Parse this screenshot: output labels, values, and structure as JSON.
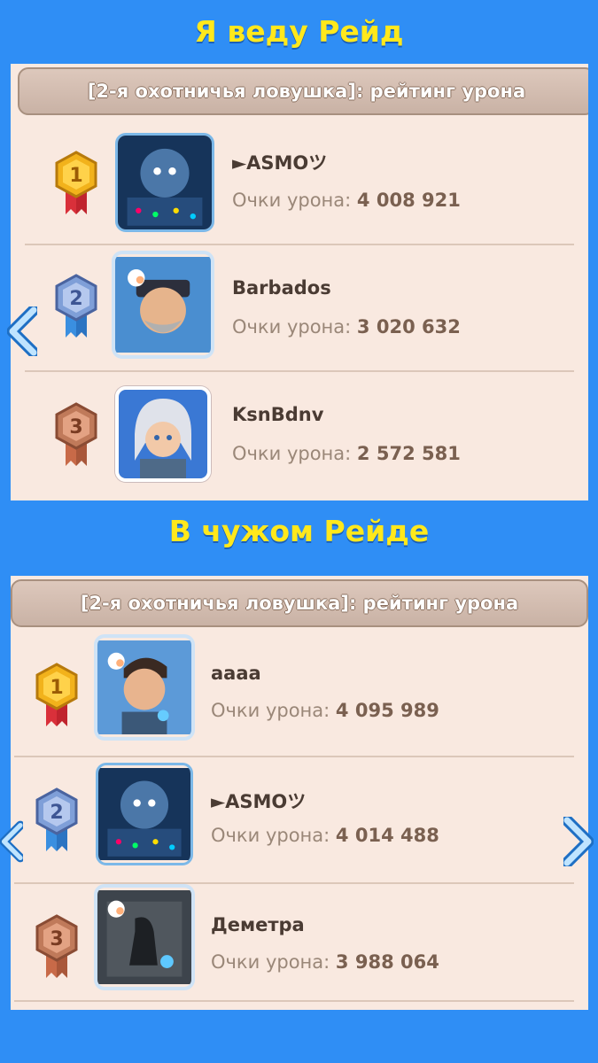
{
  "captions": {
    "top": "Я веду Рейд",
    "bottom": "В чужом Рейде"
  },
  "panels": [
    {
      "header": "[2-я охотничья ловушка]: рейтинг урона",
      "rows": [
        {
          "rank": "1",
          "name": "►ASMOツ",
          "score_label": "Очки урона:",
          "score": "4 008 921",
          "avatar": "yeti-avatar-icon"
        },
        {
          "rank": "2",
          "name": "Barbados",
          "score_label": "Очки урона:",
          "score": "3 020 632",
          "avatar": "captain-avatar-icon"
        },
        {
          "rank": "3",
          "name": "KsnBdnv",
          "score_label": "Очки урона:",
          "score": "2 572 581",
          "avatar": "white-haired-avatar-icon"
        }
      ]
    },
    {
      "header": "[2-я охотничья ловушка]: рейтинг урона",
      "rows": [
        {
          "rank": "1",
          "name": "aaaa",
          "score_label": "Очки урона:",
          "score": "4 095 989",
          "avatar": "hero-avatar-icon"
        },
        {
          "rank": "2",
          "name": "►ASMOツ",
          "score_label": "Очки урона:",
          "score": "4 014 488",
          "avatar": "yeti-avatar-icon"
        },
        {
          "rank": "3",
          "name": "Деметра",
          "score_label": "Очки урона:",
          "score": "3 988 064",
          "avatar": "dark-figure-avatar-icon"
        }
      ]
    }
  ],
  "colors": {
    "background": "#2f8ef5",
    "caption": "#ffe81c",
    "panel": "#f9e9e0",
    "gold": "#f2b21b",
    "silver": "#7f9fd8",
    "bronze": "#c07a5a"
  }
}
